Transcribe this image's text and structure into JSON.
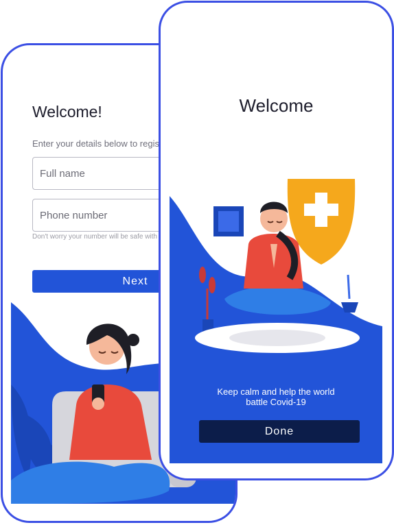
{
  "registration": {
    "title": "Welcome!",
    "subtitle": "Enter your details below to register",
    "full_name_placeholder": "Full name",
    "phone_placeholder": "Phone number",
    "hint": "Don't worry your number will be safe with us.",
    "next_label": "Next"
  },
  "welcome": {
    "title": "Welcome",
    "message_line1": "Keep calm and help the world",
    "message_line2": "battle Covid-19",
    "done_label": "Done"
  },
  "colors": {
    "frame": "#3b4fe4",
    "primary_blue": "#2254d8",
    "dark_navy": "#0c1d4a",
    "shield_orange": "#f5a81c",
    "shirt_red": "#e84a3c"
  },
  "icons": [
    "woman-with-phone-illustration",
    "meditating-man-illustration",
    "medical-shield-icon",
    "plant-icon",
    "picture-frame-icon"
  ]
}
